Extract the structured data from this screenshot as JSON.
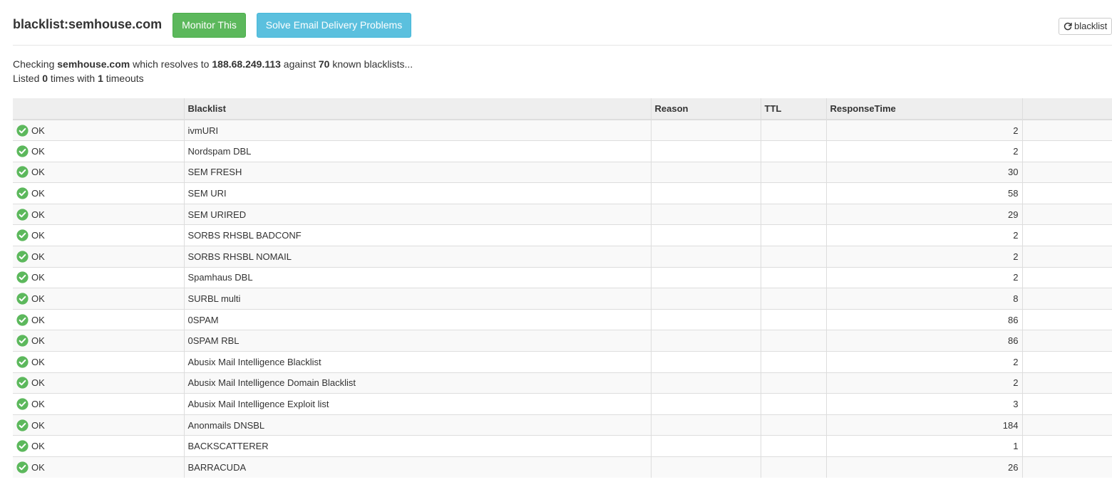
{
  "header": {
    "title": "blacklist:semhouse.com",
    "monitor_label": "Monitor This",
    "solve_label": "Solve Email Delivery Problems",
    "refresh_label": "blacklist"
  },
  "summary": {
    "checking_prefix": "Checking ",
    "domain": "semhouse.com",
    "resolves_text": " which resolves to ",
    "ip": "188.68.249.113",
    "against_text": " against ",
    "known_count": "70",
    "known_suffix": " known blacklists...",
    "listed_prefix": "Listed ",
    "listed_count": "0",
    "times_with": " times with ",
    "timeouts_count": "1",
    "timeouts_suffix": " timeouts"
  },
  "table": {
    "columns": [
      "",
      "Blacklist",
      "Reason",
      "TTL",
      "ResponseTime",
      ""
    ],
    "rows": [
      {
        "status": "OK",
        "blacklist": "ivmURI",
        "reason": "",
        "ttl": "",
        "response_time": "2"
      },
      {
        "status": "OK",
        "blacklist": "Nordspam DBL",
        "reason": "",
        "ttl": "",
        "response_time": "2"
      },
      {
        "status": "OK",
        "blacklist": "SEM FRESH",
        "reason": "",
        "ttl": "",
        "response_time": "30"
      },
      {
        "status": "OK",
        "blacklist": "SEM URI",
        "reason": "",
        "ttl": "",
        "response_time": "58"
      },
      {
        "status": "OK",
        "blacklist": "SEM URIRED",
        "reason": "",
        "ttl": "",
        "response_time": "29"
      },
      {
        "status": "OK",
        "blacklist": "SORBS RHSBL BADCONF",
        "reason": "",
        "ttl": "",
        "response_time": "2"
      },
      {
        "status": "OK",
        "blacklist": "SORBS RHSBL NOMAIL",
        "reason": "",
        "ttl": "",
        "response_time": "2"
      },
      {
        "status": "OK",
        "blacklist": "Spamhaus DBL",
        "reason": "",
        "ttl": "",
        "response_time": "2"
      },
      {
        "status": "OK",
        "blacklist": "SURBL multi",
        "reason": "",
        "ttl": "",
        "response_time": "8"
      },
      {
        "status": "OK",
        "blacklist": "0SPAM",
        "reason": "",
        "ttl": "",
        "response_time": "86"
      },
      {
        "status": "OK",
        "blacklist": "0SPAM RBL",
        "reason": "",
        "ttl": "",
        "response_time": "86"
      },
      {
        "status": "OK",
        "blacklist": "Abusix Mail Intelligence Blacklist",
        "reason": "",
        "ttl": "",
        "response_time": "2"
      },
      {
        "status": "OK",
        "blacklist": "Abusix Mail Intelligence Domain Blacklist",
        "reason": "",
        "ttl": "",
        "response_time": "2"
      },
      {
        "status": "OK",
        "blacklist": "Abusix Mail Intelligence Exploit list",
        "reason": "",
        "ttl": "",
        "response_time": "3"
      },
      {
        "status": "OK",
        "blacklist": "Anonmails DNSBL",
        "reason": "",
        "ttl": "",
        "response_time": "184"
      },
      {
        "status": "OK",
        "blacklist": "BACKSCATTERER",
        "reason": "",
        "ttl": "",
        "response_time": "1"
      },
      {
        "status": "OK",
        "blacklist": "BARRACUDA",
        "reason": "",
        "ttl": "",
        "response_time": "26"
      }
    ]
  },
  "colors": {
    "ok_icon": "#5cb85c",
    "monitor_button": "#5cb85c",
    "solve_button": "#5bc0de"
  },
  "icons": {
    "status_ok": "check-circle-icon",
    "refresh": "refresh-icon"
  }
}
